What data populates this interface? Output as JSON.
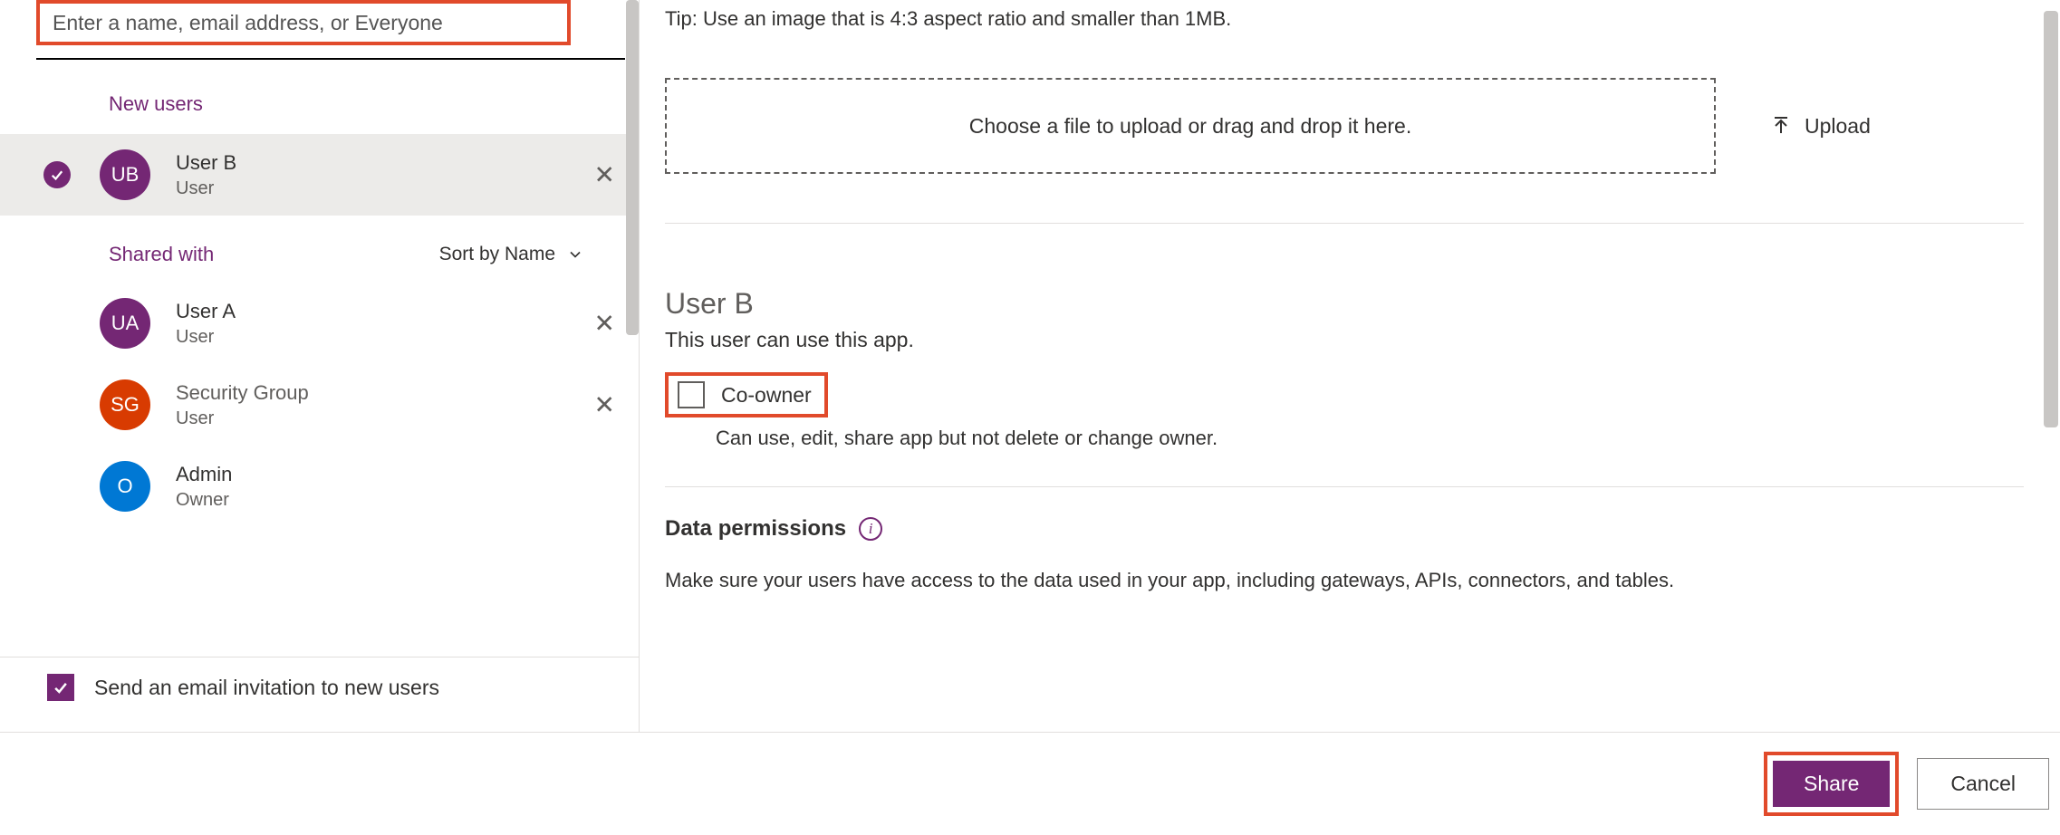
{
  "search": {
    "placeholder": "Enter a name, email address, or Everyone"
  },
  "sections": {
    "new_users": "New users",
    "shared_with": "Shared with",
    "sort_label": "Sort by Name"
  },
  "users": {
    "selected": {
      "initials": "UB",
      "name": "User B",
      "role": "User"
    },
    "shared": [
      {
        "initials": "UA",
        "name": "User A",
        "role": "User",
        "color": "purple",
        "removable": true
      },
      {
        "initials": "SG",
        "name": "Security Group",
        "role": "User",
        "color": "red",
        "removable": true
      },
      {
        "initials": "O",
        "name": "Admin",
        "role": "Owner",
        "color": "blue",
        "removable": false
      }
    ]
  },
  "email_invite": {
    "label": "Send an email invitation to new users",
    "checked": true
  },
  "upload": {
    "tip": "Tip: Use an image that is 4:3 aspect ratio and smaller than 1MB.",
    "dropzone": "Choose a file to upload or drag and drop it here.",
    "button": "Upload"
  },
  "detail": {
    "title": "User B",
    "subtitle": "This user can use this app.",
    "coowner_label": "Co-owner",
    "coowner_desc": "Can use, edit, share app but not delete or change owner."
  },
  "data_permissions": {
    "title": "Data permissions",
    "text": "Make sure your users have access to the data used in your app, including gateways, APIs, connectors, and tables."
  },
  "buttons": {
    "share": "Share",
    "cancel": "Cancel"
  }
}
